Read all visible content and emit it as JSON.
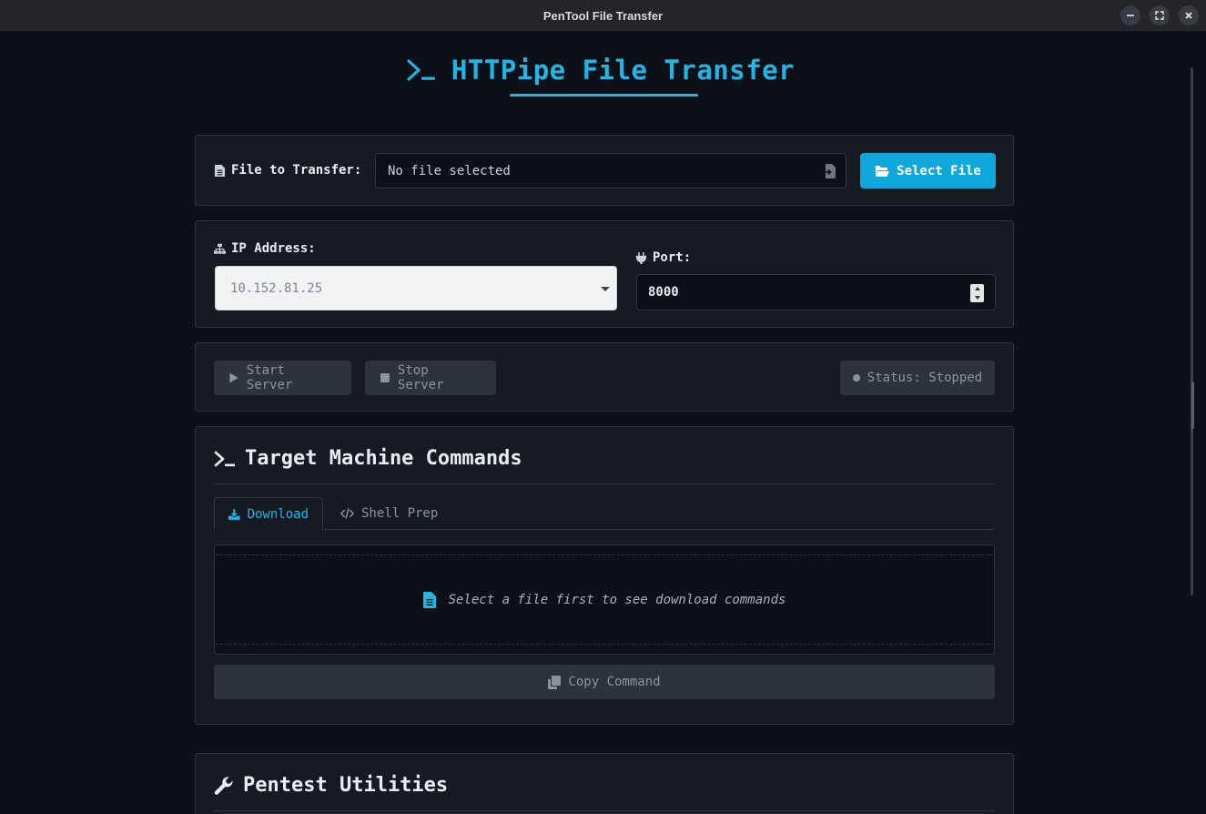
{
  "window": {
    "title": "PenTool File Transfer"
  },
  "header": {
    "title": "HTTPipe File Transfer"
  },
  "file": {
    "label": "File to Transfer:",
    "value": "No file selected",
    "select_button": "Select File"
  },
  "network": {
    "ip_label": "IP Address:",
    "ip_value": "10.152.81.25",
    "port_label": "Port:",
    "port_value": "8000"
  },
  "server": {
    "start_label": "Start Server",
    "stop_label": "Stop Server",
    "status_text": "Status: Stopped"
  },
  "commands": {
    "title": "Target Machine Commands",
    "tabs": [
      {
        "label": "Download",
        "active": true
      },
      {
        "label": "Shell Prep",
        "active": false
      }
    ],
    "placeholder": "Select a file first to see download commands",
    "copy_label": "Copy Command"
  },
  "utilities": {
    "title": "Pentest Utilities"
  },
  "colors": {
    "accent": "#1db6e6",
    "background": "#0d1117",
    "card": "#161b22",
    "button_disabled": "#2d333b"
  },
  "icons": [
    "terminal-icon",
    "file-icon",
    "file-import-icon",
    "folder-open-icon",
    "network-icon",
    "plug-icon",
    "play-icon",
    "stop-icon",
    "status-dot-icon",
    "download-icon",
    "code-icon",
    "copy-icon",
    "wrench-icon",
    "minimize-icon",
    "maximize-icon",
    "close-icon"
  ]
}
